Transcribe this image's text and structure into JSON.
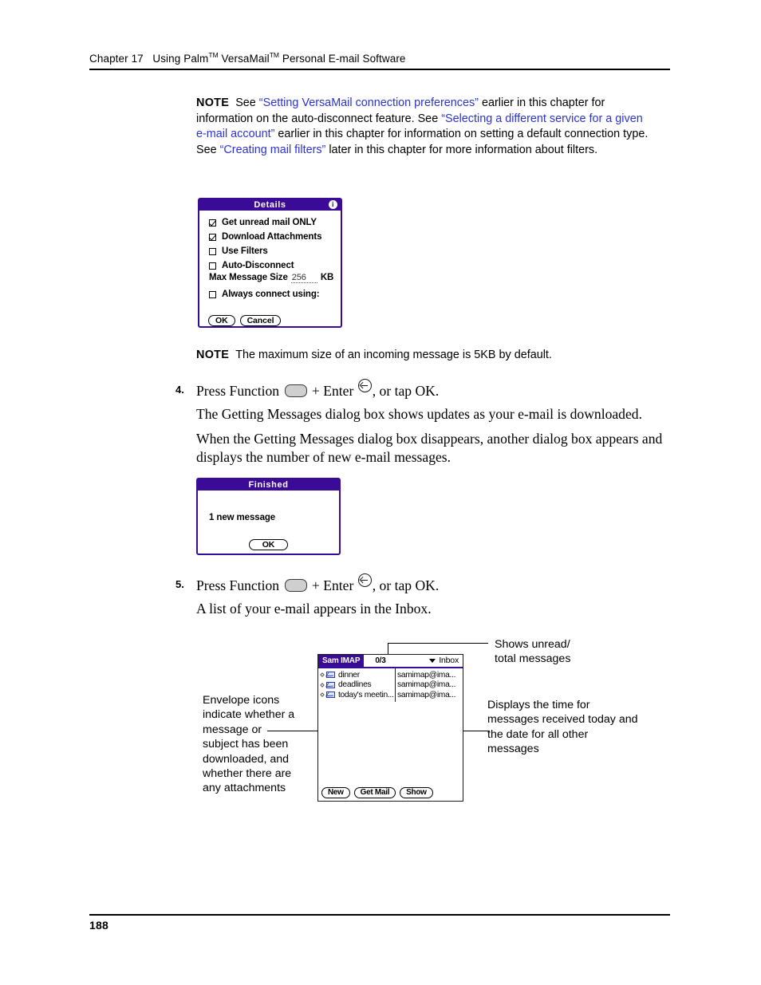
{
  "header": {
    "chapter": "Chapter 17",
    "title_a": "Using Palm",
    "tm1": "TM",
    "title_b": " VersaMail",
    "tm2": "TM",
    "title_c": " Personal E-mail Software"
  },
  "footer": {
    "page_number": "188"
  },
  "note1": {
    "label": "NOTE",
    "t1": "See ",
    "link1": "“Setting VersaMail connection preferences”",
    "t2": " earlier in this chapter for information on the auto-disconnect feature. See ",
    "link2": "“Selecting a different service for a given e-mail account”",
    "t3": " earlier in this chapter for information on setting a default connection type. See ",
    "link3": "“Creating mail filters”",
    "t4": " later in this chapter for more information about filters."
  },
  "note2": {
    "label": "NOTE",
    "text": "The maximum size of an incoming message is 5KB by default."
  },
  "details_dialog": {
    "title": "Details",
    "info_icon": "info-icon",
    "options": [
      {
        "label": "Get unread mail ONLY",
        "checked": true
      },
      {
        "label": "Download Attachments",
        "checked": true
      },
      {
        "label": "Use Filters",
        "checked": false
      },
      {
        "label": "Auto-Disconnect",
        "checked": false
      }
    ],
    "max_size_label": "Max Message Size",
    "max_size_value": "256",
    "max_size_unit": "KB",
    "always_connect_label": "Always connect using:",
    "always_connect_checked": false,
    "ok_label": "OK",
    "cancel_label": "Cancel"
  },
  "step4": {
    "number": "4.",
    "text_a": "Press Function ",
    "fn_icon": "function-key-icon",
    "text_b": " + Enter ",
    "enter_icon": "enter-key-icon",
    "text_c": ", or tap OK.",
    "para1": "The Getting Messages dialog box shows updates as your e-mail is downloaded.",
    "para2": "When the Getting Messages dialog box disappears, another dialog box appears and displays the number of new e-mail messages."
  },
  "finished_dialog": {
    "title": "Finished",
    "message": "1 new message",
    "ok_label": "OK"
  },
  "step5": {
    "number": "5.",
    "text_a": "Press Function ",
    "fn_icon": "function-key-icon",
    "text_b": " + Enter ",
    "enter_icon": "enter-key-icon",
    "text_c": ", or tap OK.",
    "para1": "A list of your e-mail appears in the Inbox."
  },
  "inbox": {
    "account": "Sam IMAP",
    "count": "0/3",
    "folder": "Inbox",
    "folder_caret": "chevron-down-icon",
    "messages": [
      {
        "subject": "dinner",
        "from": "samimap@ima..."
      },
      {
        "subject": "deadlines",
        "from": "samimap@ima..."
      },
      {
        "subject": "today's meetin...",
        "from": "samimap@ima..."
      }
    ],
    "buttons": [
      "New",
      "Get Mail",
      "Show"
    ]
  },
  "callouts": {
    "unread": "Shows unread/\ntotal messages",
    "envelope": "Envelope icons indicate whether a message or subject has been downloaded, and whether there are any attachments",
    "time": "Displays the time for messages received today and the date for all other messages"
  },
  "colors": {
    "palm_purple": "#3a0b96",
    "link_blue": "#2b33d4",
    "envelope_blue": "#1c39c4"
  }
}
